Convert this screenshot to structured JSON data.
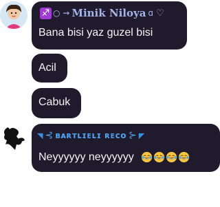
{
  "messages": [
    {
      "sender": {
        "zodiac": "♐",
        "deco_left": "○ ⇝",
        "name": "Minik Niloya",
        "deco_right": "ɑ",
        "heart": "♡"
      },
      "text": "Bana bisi yaz guzel bisi"
    },
    {
      "text": "Acil"
    },
    {
      "text": "Cabuk"
    },
    {
      "sender": {
        "deco_left": "◥",
        "swirl_left": "⊰",
        "name": "ʙᴀʀтʟɪᴇʟɪ ʀᴇᴄᴏ",
        "swirl_right": "⊱",
        "deco_right": "◤"
      },
      "text": "Neyyyyyy neyyyyyy",
      "emoji": [
        "face-with-tears-of-joy",
        "face-with-tears-of-joy",
        "face-with-tears-of-joy",
        "face-with-tears-of-joy"
      ]
    }
  ],
  "colors": {
    "bubble": "#1f1a2c",
    "name_1": "#a7b4e8",
    "name_2": "#4aa3f0",
    "zodiac_bg": "#a03bd6"
  }
}
